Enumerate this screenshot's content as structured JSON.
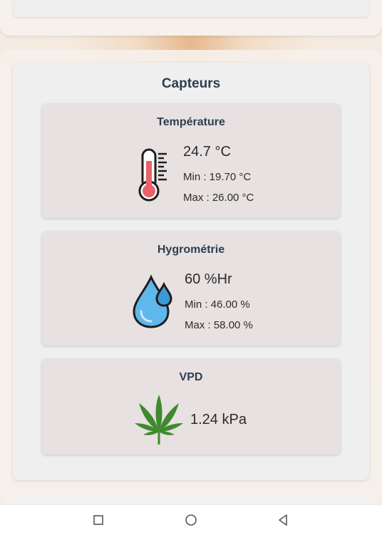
{
  "sensors": {
    "title": "Capteurs",
    "temperature": {
      "title": "Température",
      "value": "24.7 °C",
      "min": "Min : 19.70 °C",
      "max": "Max : 26.00 °C",
      "icon": "thermometer-icon"
    },
    "humidity": {
      "title": "Hygrométrie",
      "value": "60 %Hr",
      "min": "Min : 46.00 %",
      "max": "Max : 58.00 %",
      "icon": "water-drops-icon"
    },
    "vpd": {
      "title": "VPD",
      "value": "1.24 kPa",
      "icon": "cannabis-leaf-icon"
    }
  },
  "navbar": {
    "buttons": [
      "recent-apps",
      "home",
      "back"
    ]
  },
  "colors": {
    "title_text": "#2c3e50",
    "card_bg": "#e8e1e1",
    "panel_bg": "#efeff0",
    "thermo_red": "#e8626a",
    "drop_blue": "#5fb8ec",
    "leaf_green": "#3f8a2f"
  }
}
